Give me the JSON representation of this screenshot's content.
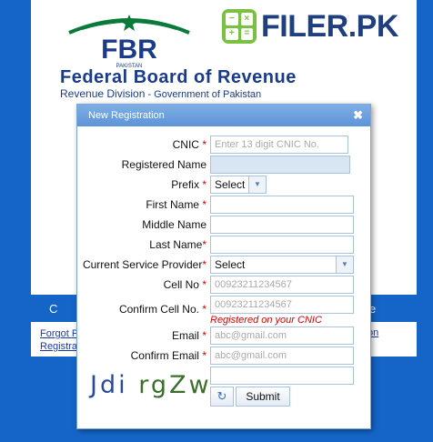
{
  "header": {
    "fbr_logo_text": "FBR",
    "fbr_logo_subtext": "PAKISTAN",
    "title": "Federal Board of Revenue",
    "subtitle_main": "Revenue Division",
    "subtitle_rest": " - Government of Pakistan"
  },
  "filer_logo": {
    "calc_glyphs": [
      "−",
      "×",
      "+",
      "="
    ],
    "brand": "FILER.",
    "brand_pk": "PK"
  },
  "background_bar": {
    "left": "C",
    "right": "e"
  },
  "background_links": {
    "link1": "Forgot P",
    "link2": "Registra",
    "link3": "on"
  },
  "dialog": {
    "title": "New Registration",
    "close_icon": "✖",
    "cnic": {
      "label": "CNIC",
      "placeholder": "Enter 13 digit CNIC No."
    },
    "registered_name": {
      "label": "Registered Name"
    },
    "prefix": {
      "label": "Prefix",
      "value": "Select"
    },
    "first_name": {
      "label": "First Name"
    },
    "middle_name": {
      "label": "Middle Name"
    },
    "last_name": {
      "label": "Last Name"
    },
    "service_provider": {
      "label": "Current Service Provider",
      "value": "Select"
    },
    "cell_no": {
      "label": "Cell No",
      "placeholder": "00923211234567"
    },
    "confirm_cell_no": {
      "label": "Confirm Cell No.",
      "placeholder": "00923211234567",
      "hint": "Registered on your CNIC"
    },
    "email": {
      "label": "Email",
      "placeholder": "abc@gmail.com"
    },
    "confirm_email": {
      "label": "Confirm Email",
      "placeholder": "abc@gmail.com"
    },
    "captcha": {
      "part1": "Jdi",
      "part2": "rgZw"
    },
    "refresh_icon": "↻",
    "submit_label": "Submit",
    "required_mark": "*"
  }
}
